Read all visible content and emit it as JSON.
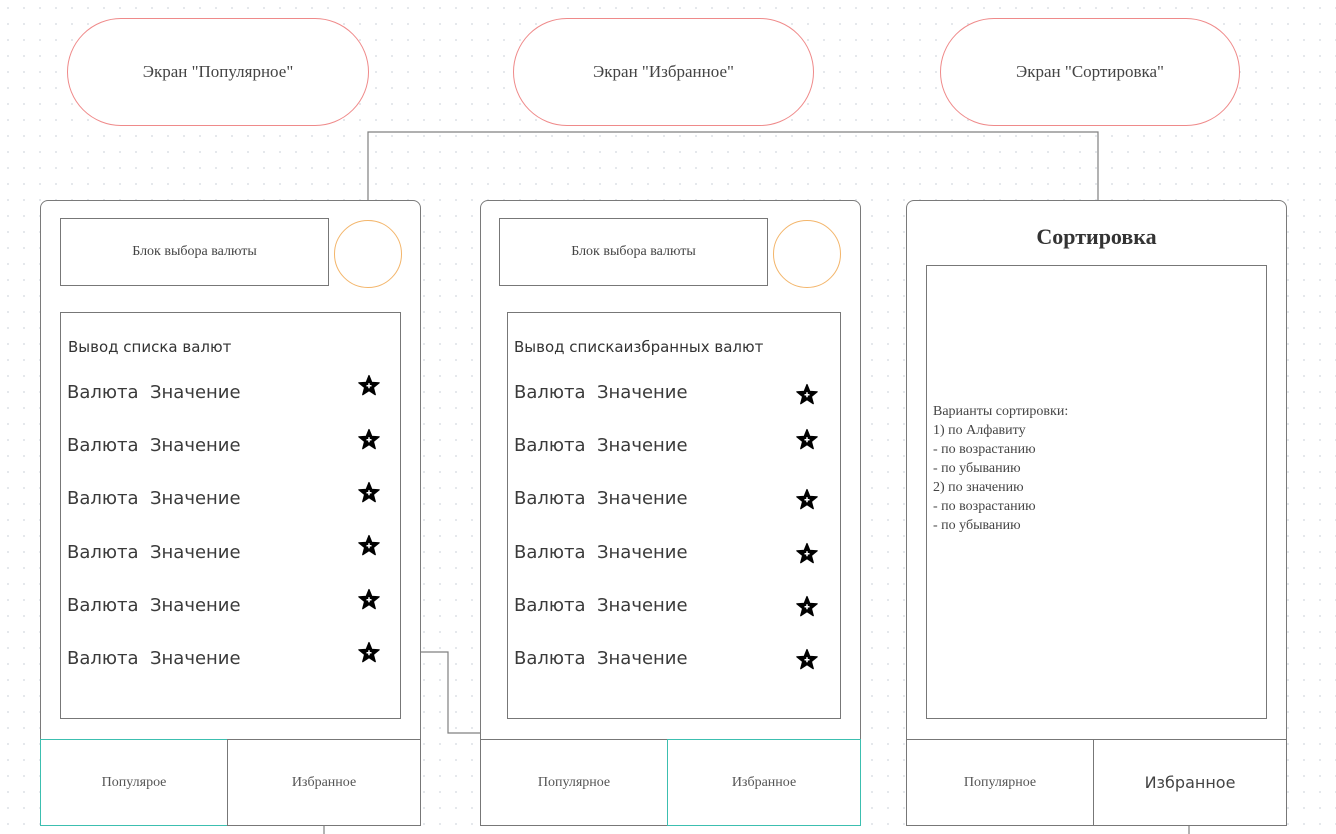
{
  "screens": [
    {
      "heading": "Экран \"Популярное\"",
      "selector": "Блок выбора валюты",
      "list_title": "Вывод списка валют",
      "rows": [
        "Валюта  Значение",
        "Валюта  Значение",
        "Валюта  Значение",
        "Валюта  Значение",
        "Валюта  Значение",
        "Валюта  Значение"
      ],
      "tabs": [
        "Популяроe",
        "Избранное"
      ]
    },
    {
      "heading": "Экран \"Избранное\"",
      "selector": "Блок выбора валюты",
      "list_title": "Вывод спискаизбранных валют",
      "rows": [
        "Валюта  Значение",
        "Валюта  Значение",
        "Валюта  Значение",
        "Валюта  Значение",
        "Валюта  Значение",
        "Валюта  Значение"
      ],
      "tabs": [
        "Популярное",
        "Избранное"
      ]
    },
    {
      "heading": "Экран \"Сортировка\"",
      "title": "Сортировка",
      "options_text": "Варианты сортировки:\n1) по Алфавиту\n- по возрастанию\n- по убыванию\n2) по значению\n-  по возрастанию\n- по убыванию",
      "tabs": [
        "Популярное",
        "Избранное"
      ]
    }
  ],
  "colors": {
    "pill_border": "#ef8a8a",
    "avatar_border": "#f3b56a",
    "active_tab_border": "#3cbfb0",
    "outline": "#777777",
    "connector": "#808080"
  },
  "icons": {
    "row_icon": "star-icon"
  }
}
